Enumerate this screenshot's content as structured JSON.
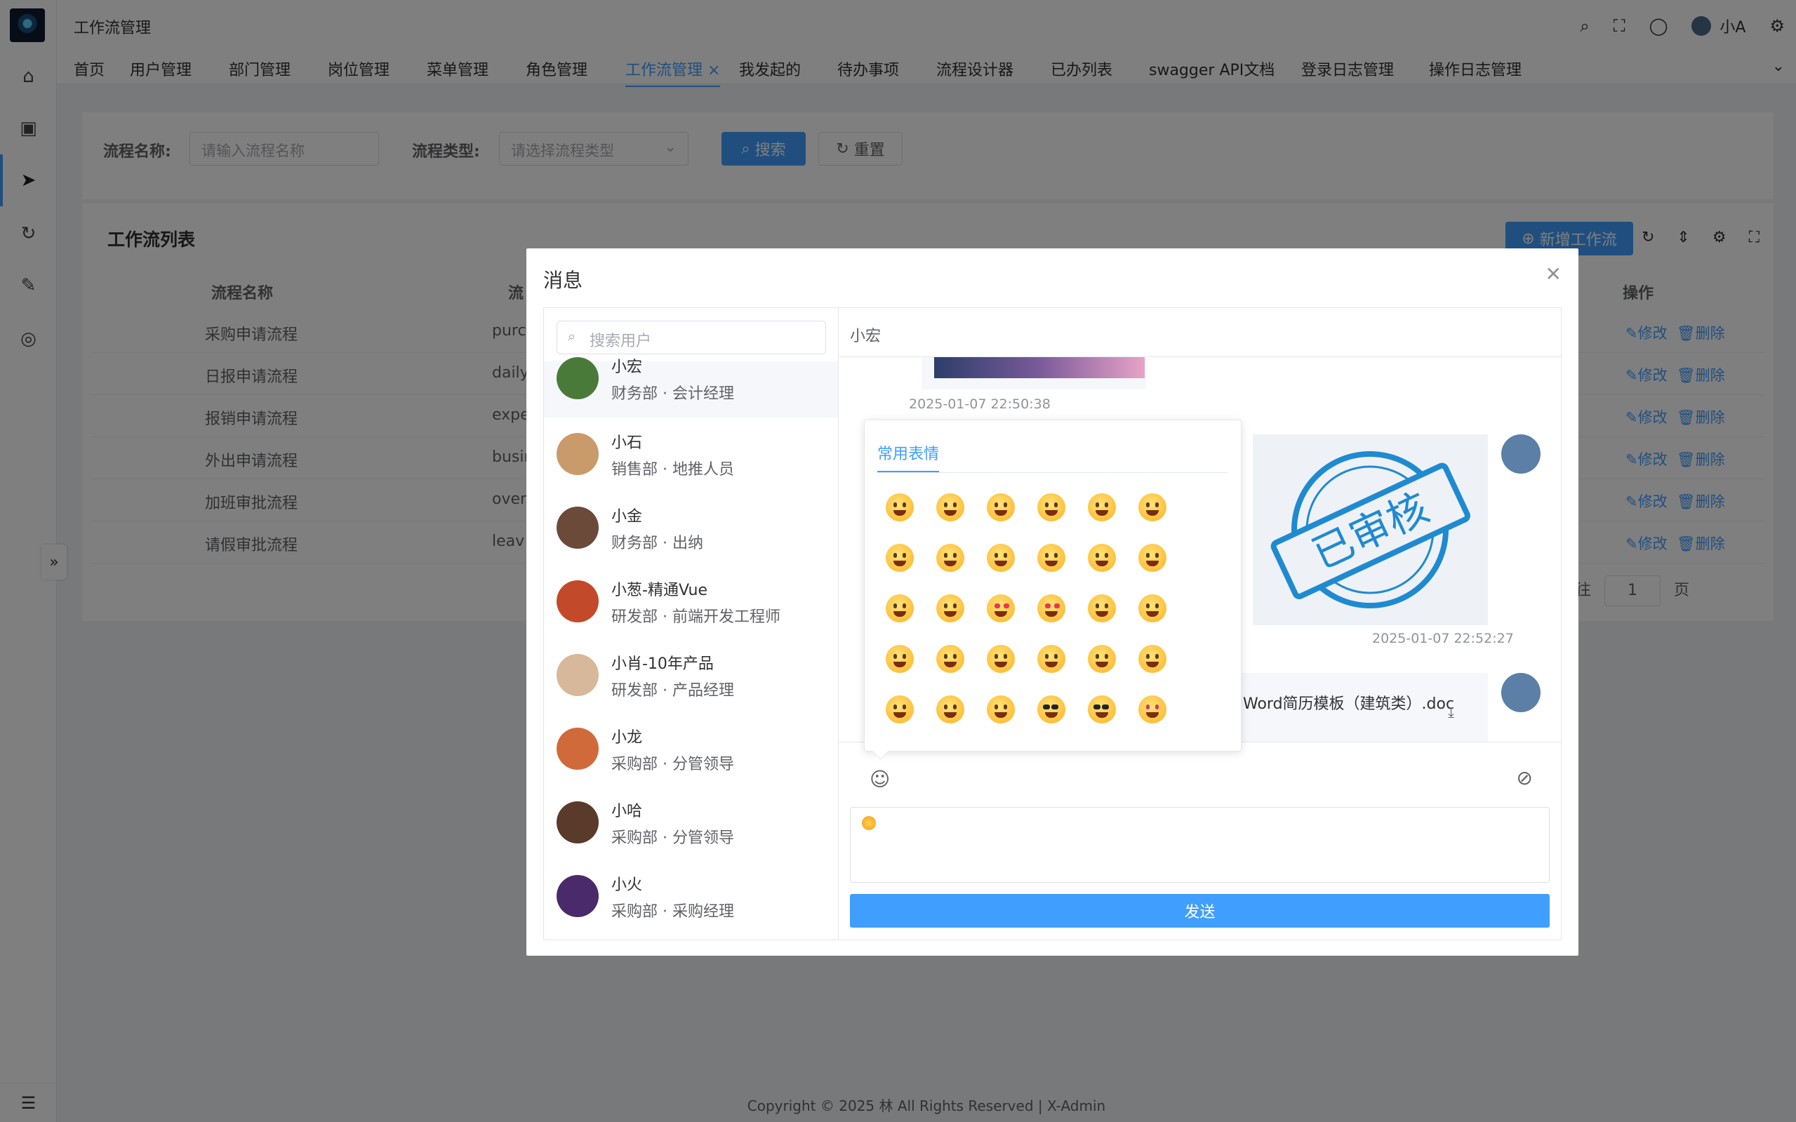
{
  "header": {
    "title": "工作流管理",
    "user_name": "小A"
  },
  "tabs": [
    {
      "label": "首页"
    },
    {
      "label": "用户管理"
    },
    {
      "label": "部门管理"
    },
    {
      "label": "岗位管理"
    },
    {
      "label": "菜单管理"
    },
    {
      "label": "角色管理"
    },
    {
      "label": "工作流管理",
      "close": "×"
    },
    {
      "label": "我发起的"
    },
    {
      "label": "待办事项"
    },
    {
      "label": "流程设计器"
    },
    {
      "label": "已办列表"
    },
    {
      "label": "swagger API文档"
    },
    {
      "label": "登录日志管理"
    },
    {
      "label": "操作日志管理"
    }
  ],
  "search": {
    "name_label": "流程名称:",
    "name_placeholder": "请输入流程名称",
    "type_label": "流程类型:",
    "type_placeholder": "请选择流程类型",
    "search_btn": "搜索",
    "reset_btn": "重置"
  },
  "list": {
    "title": "工作流列表",
    "add_btn": "新增工作流",
    "col_name": "流程名称",
    "col_code": "流",
    "col_ops": "操作",
    "edit": "修改",
    "delete": "删除",
    "rows": [
      {
        "name": "采购申请流程",
        "code": "purch"
      },
      {
        "name": "日报申请流程",
        "code": "daily_"
      },
      {
        "name": "报销申请流程",
        "code": "expe"
      },
      {
        "name": "外出申请流程",
        "code": "busin"
      },
      {
        "name": "加班审批流程",
        "code": "overt"
      },
      {
        "name": "请假审批流程",
        "code": "leav"
      }
    ],
    "pager_goto": "前往",
    "pager_page": "1",
    "pager_unit": "页"
  },
  "footer": "Copyright © 2025 林 All Rights Reserved | X-Admin",
  "dialog": {
    "title": "消息",
    "search_placeholder": "搜索用户",
    "users": [
      {
        "name": "小宏",
        "dept": "财务部 · 会计经理"
      },
      {
        "name": "小石",
        "dept": "销售部 · 地推人员"
      },
      {
        "name": "小金",
        "dept": "财务部 · 出纳"
      },
      {
        "name": "小葱-精通Vue",
        "dept": "研发部 · 前端开发工程师"
      },
      {
        "name": "小肖-10年产品",
        "dept": "研发部 · 产品经理"
      },
      {
        "name": "小龙",
        "dept": "采购部 · 分管领导"
      },
      {
        "name": "小哈",
        "dept": "采购部 · 分管领导"
      },
      {
        "name": "小火",
        "dept": "采购部 · 采购经理"
      }
    ],
    "conversation_with": "小宏",
    "messages": {
      "ts1": "2025-01-07 22:50:38",
      "stamp_text": "已审核",
      "ts2": "2025-01-07 22:52:27",
      "file_name": "Word简历模板（建筑类）.doc"
    },
    "emoji_tab": "常用表情",
    "send_btn": "发送"
  }
}
